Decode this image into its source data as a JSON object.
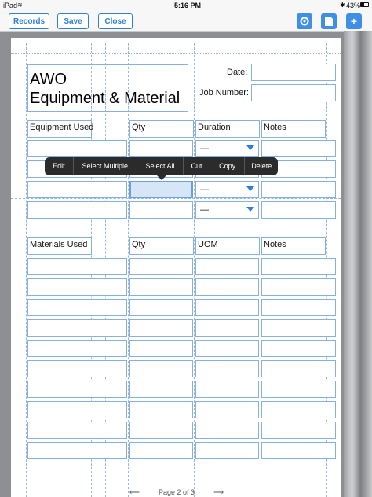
{
  "status_bar": {
    "device": "iPad",
    "time": "5:16 PM",
    "battery": "43%"
  },
  "toolbar": {
    "records_label": "Records",
    "save_label": "Save",
    "close_label": "Close",
    "new_label": "+"
  },
  "form": {
    "title_line1": "AWO",
    "title_line2": "Equipment & Material",
    "date_label": "Date:",
    "job_number_label": "Job Number:",
    "equipment_headers": [
      "Equipment Used",
      "Qty",
      "Duration",
      "Notes"
    ],
    "duration_values": [
      "—",
      "—",
      "—"
    ],
    "materials_headers": [
      "Materials Used",
      "Qty",
      "UOM",
      "Notes"
    ]
  },
  "context_menu": {
    "items": [
      "Edit",
      "Select Multiple",
      "Select All",
      "Cut",
      "Copy",
      "Delete"
    ]
  },
  "pager": {
    "label": "Page 2 of 3",
    "prev": "⟵",
    "next": "⟶"
  },
  "colors": {
    "accent": "#2f7fd8",
    "field_border": "#87b0de",
    "menu_bg": "#2b2b2b"
  }
}
